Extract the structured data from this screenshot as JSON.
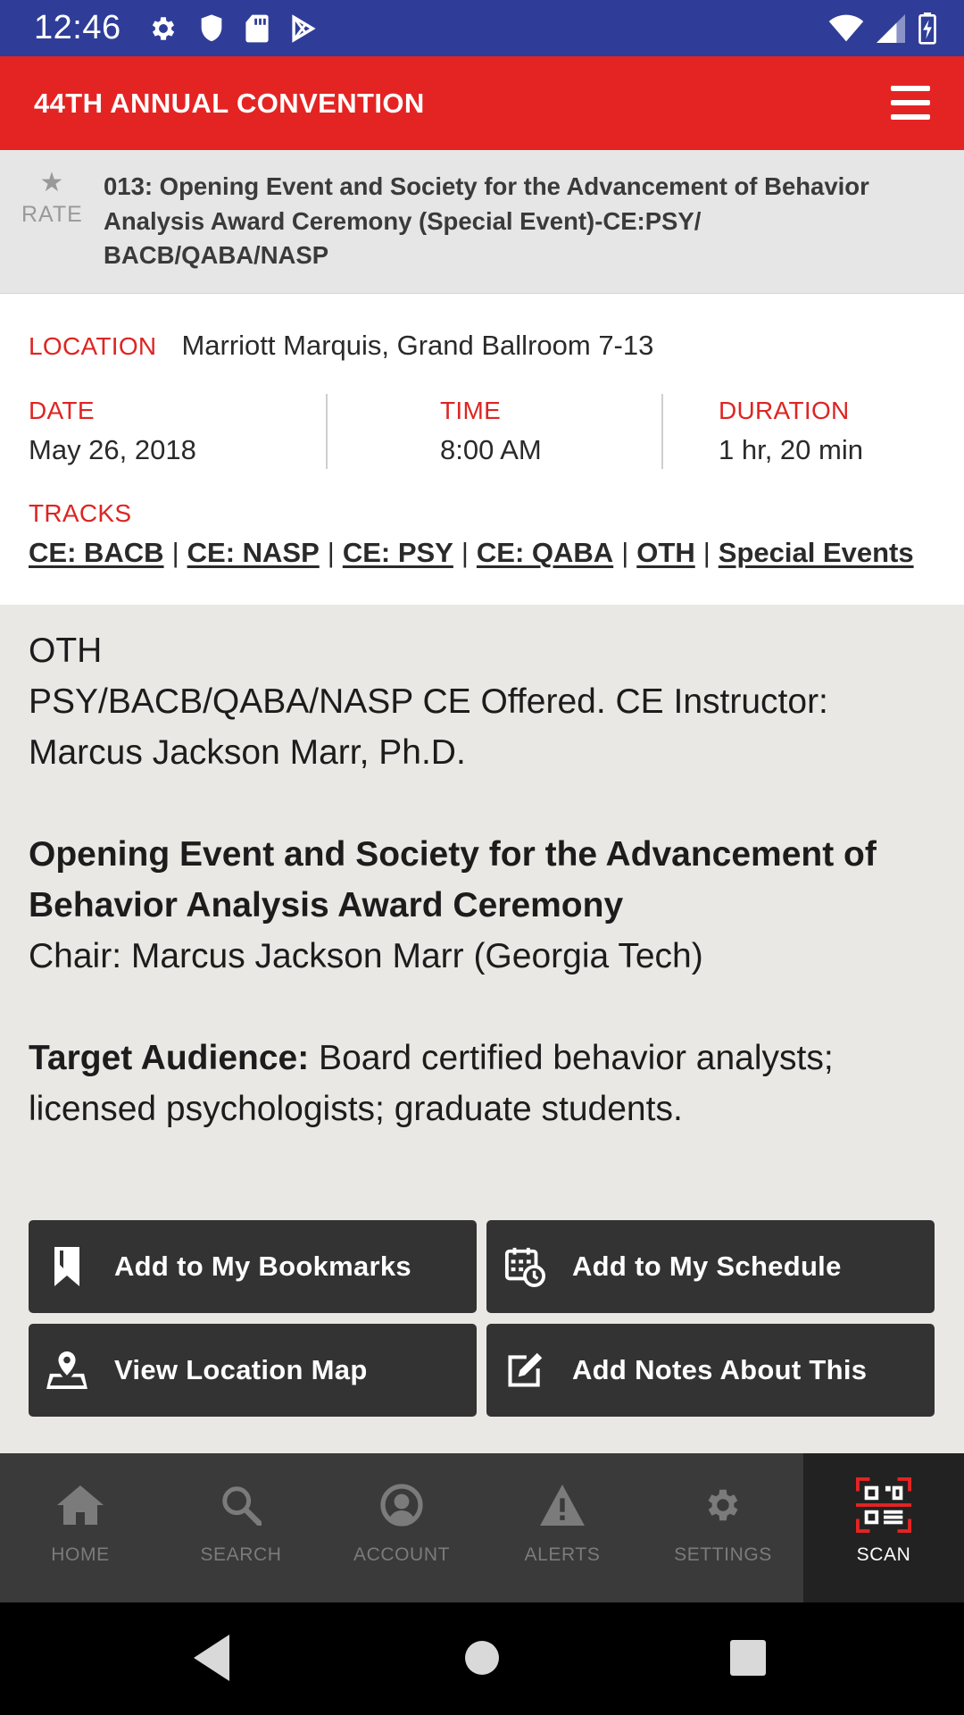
{
  "status_bar": {
    "time": "12:46",
    "left_icons": [
      "gear-icon",
      "shield-icon",
      "sd-card-icon",
      "play-store-icon"
    ],
    "right_icons": [
      "wifi-icon",
      "signal-icon",
      "battery-icon"
    ]
  },
  "app_bar": {
    "title": "44TH ANNUAL CONVENTION",
    "menu_icon": "hamburger-menu-icon"
  },
  "session": {
    "rate_label": "RATE",
    "title": "013: Opening Event and Society for the Advancement of Behavior Analysis Award Ceremony (Special Event)-CE:PSY/ BACB/QABA/NASP"
  },
  "info": {
    "location_label": "LOCATION",
    "location": "Marriott Marquis, Grand Ballroom 7-13",
    "date_label": "DATE",
    "date": "May 26, 2018",
    "time_label": "TIME",
    "time": "8:00 AM",
    "duration_label": "DURATION",
    "duration": "1 hr, 20 min",
    "tracks_label": "TRACKS",
    "tracks": [
      "CE: BACB",
      "CE: NASP",
      "CE: PSY",
      "CE: QABA",
      "OTH",
      "Special Events"
    ],
    "track_separator": "|"
  },
  "description": {
    "line1": "OTH",
    "line2": "PSY/BACB/QABA/NASP CE Offered. CE Instructor: Marcus Jackson Marr, Ph.D.",
    "heading": "Opening Event and Society for the Advancement of Behavior Analysis Award Ceremony",
    "chair": "Chair: Marcus Jackson Marr (Georgia Tech)",
    "audience_label": "Target Audience:",
    "audience_text": " Board certified behavior analysts; licensed psychologists; graduate students."
  },
  "actions": {
    "bookmarks": "Add to My Bookmarks",
    "schedule": "Add to My Schedule",
    "map": "View Location Map",
    "notes": "Add Notes About This"
  },
  "bottom_nav": {
    "home": "HOME",
    "search": "SEARCH",
    "account": "ACCOUNT",
    "alerts": "ALERTS",
    "settings": "SETTINGS",
    "scan": "SCAN",
    "active": "scan"
  },
  "colors": {
    "status_bar": "#2f3d99",
    "app_bar": "#e42423",
    "label_red": "#dd2522",
    "button_bg": "#333333",
    "nav_bg": "#3a3a3a"
  }
}
